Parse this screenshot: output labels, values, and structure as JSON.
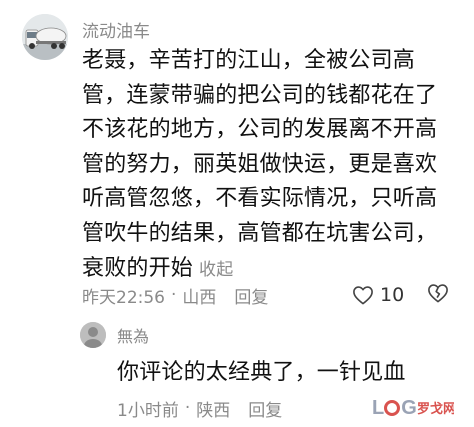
{
  "comment": {
    "username": "流动油车",
    "text": "老聂，辛苦打的江山，全被公司高管，连蒙带骗的把公司的钱都花在了不该花的地方，公司的发展离不开高管的努力，丽英姐做快运，更是喜欢听高管忽悠，不看实际情况，只听高管吹牛的结果，高管都在坑害公司，衰败的开始",
    "collapse_label": "收起",
    "time": "昨天22:56",
    "location": "山西",
    "reply_label": "回复",
    "like_count": "10"
  },
  "reply": {
    "username": "無為",
    "text": "你评论的太经典了，一针见血",
    "time": "1小时前",
    "location": "陕西",
    "reply_label": "回复"
  },
  "icons": {
    "like": "heart-outline-icon",
    "dislike": "broken-heart-icon"
  },
  "colors": {
    "meta_gray": "#8a8a8a",
    "text": "#111111",
    "watermark_red": "#d9534f"
  }
}
